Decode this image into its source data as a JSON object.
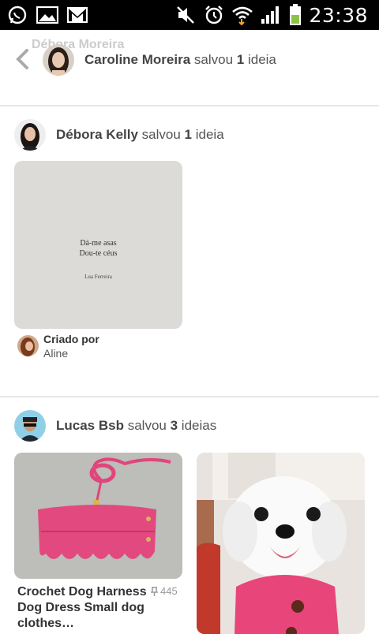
{
  "status_bar": {
    "time": "23:38",
    "left_icons": [
      "whatsapp-icon",
      "gallery-icon",
      "gmail-icon"
    ],
    "right_icons": [
      "mute-icon",
      "alarm-icon",
      "wifi-icon",
      "signal-icon",
      "battery-icon"
    ]
  },
  "header": {
    "ghost_text": "Débora Moreira",
    "user": "Caroline Moreira",
    "action": "salvou",
    "count": "1",
    "noun": "ideia"
  },
  "feed": [
    {
      "user": "Débora Kelly",
      "action": "salvou",
      "count": "1",
      "noun": "ideia",
      "pin": {
        "quote_line1": "Dá-me asas",
        "quote_line2": "Dou-te céus",
        "quote_author": "Lua Ferreira",
        "created_by_label": "Criado por",
        "creator": "Aline"
      }
    },
    {
      "user": "Lucas Bsb",
      "action": "salvou",
      "count": "3",
      "noun": "ideias",
      "pins": [
        {
          "title": "Crochet Dog Harness Dog Dress Small dog clothes…",
          "saves": "445"
        },
        {
          "title": ""
        }
      ]
    }
  ],
  "colors": {
    "accent_pink": "#e0457b",
    "divider": "#e6e6e6",
    "battery": "#8bc34a"
  }
}
